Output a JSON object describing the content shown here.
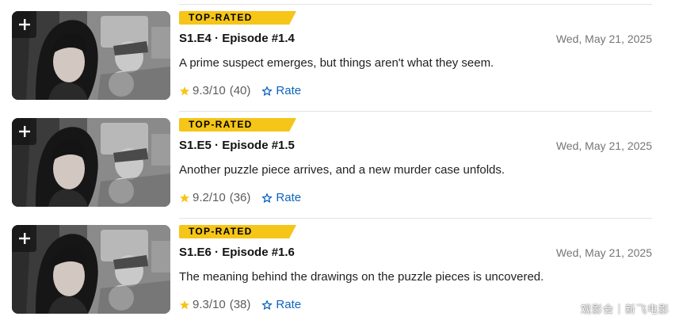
{
  "badge_label": "TOP-RATED",
  "rate_label": "Rate",
  "episodes": [
    {
      "title": "S1.E4 · Episode #1.4",
      "date": "Wed, May 21, 2025",
      "description": "A prime suspect emerges, but things aren't what they seem.",
      "rating": "9.3/10",
      "votes": "(40)"
    },
    {
      "title": "S1.E5 · Episode #1.5",
      "date": "Wed, May 21, 2025",
      "description": "Another puzzle piece arrives, and a new murder case unfolds.",
      "rating": "9.2/10",
      "votes": "(36)"
    },
    {
      "title": "S1.E6 · Episode #1.6",
      "date": "Wed, May 21, 2025",
      "description": "The meaning behind the drawings on the puzzle pieces is uncovered.",
      "rating": "9.3/10",
      "votes": "(38)"
    }
  ],
  "watermark": "观影会｜新飞电影",
  "colors": {
    "badge": "#f5c518",
    "star": "#f5c518",
    "rate_link": "#0e63be",
    "date": "#757575"
  },
  "icons": {
    "add": "plus-icon",
    "star": "star-icon",
    "rate": "star-outline-icon"
  }
}
